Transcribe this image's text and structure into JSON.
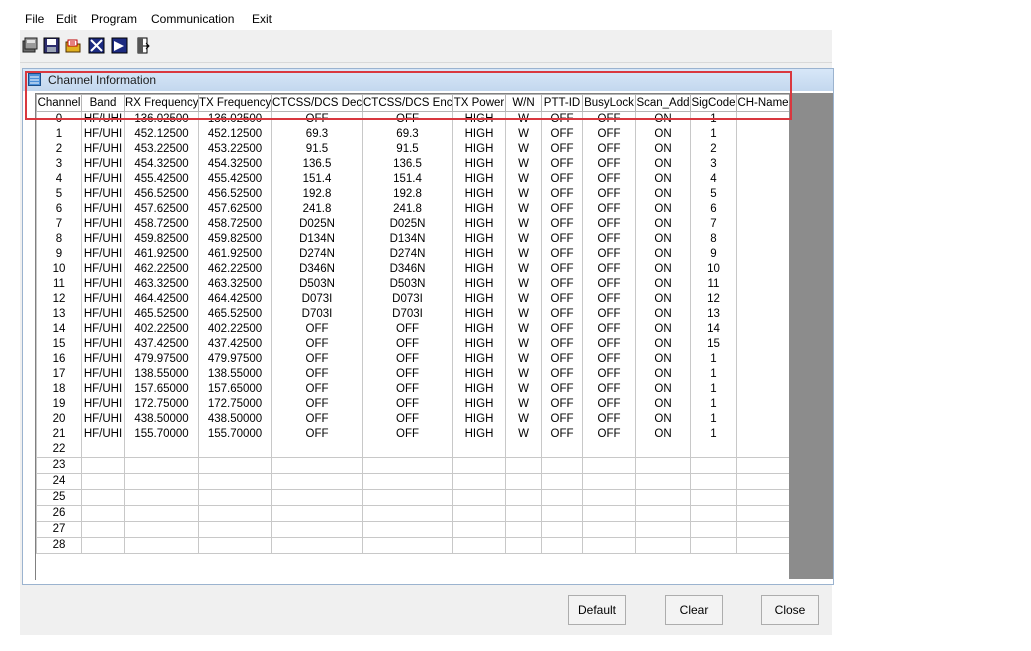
{
  "menu": [
    "File",
    "Edit",
    "Program",
    "Communication",
    "Exit"
  ],
  "toolbar": {
    "buttons": [
      {
        "name": "read-radio-icon"
      },
      {
        "name": "save-icon"
      },
      {
        "name": "open-folder-icon"
      },
      {
        "name": "write-radio-icon"
      },
      {
        "name": "read-from-radio-icon"
      },
      {
        "name": "exit-door-icon"
      }
    ]
  },
  "window": {
    "title": "Channel Information",
    "icon": "grid-window-icon"
  },
  "grid": {
    "columns": [
      "Channel",
      "Band",
      "RX Frequency",
      "TX Frequency",
      "CTCSS/DCS Dec",
      "CTCSS/DCS Enc",
      "TX Power",
      "W/N",
      "PTT-ID",
      "BusyLock",
      "Scan_Add",
      "SigCode",
      "CH-Name"
    ],
    "rows": [
      [
        "0",
        "HF/UHI",
        "136.02500",
        "136.02500",
        "OFF",
        "OFF",
        "HIGH",
        "W",
        "OFF",
        "OFF",
        "ON",
        "1",
        ""
      ],
      [
        "1",
        "HF/UHI",
        "452.12500",
        "452.12500",
        "69.3",
        "69.3",
        "HIGH",
        "W",
        "OFF",
        "OFF",
        "ON",
        "1",
        ""
      ],
      [
        "2",
        "HF/UHI",
        "453.22500",
        "453.22500",
        "91.5",
        "91.5",
        "HIGH",
        "W",
        "OFF",
        "OFF",
        "ON",
        "2",
        ""
      ],
      [
        "3",
        "HF/UHI",
        "454.32500",
        "454.32500",
        "136.5",
        "136.5",
        "HIGH",
        "W",
        "OFF",
        "OFF",
        "ON",
        "3",
        ""
      ],
      [
        "4",
        "HF/UHI",
        "455.42500",
        "455.42500",
        "151.4",
        "151.4",
        "HIGH",
        "W",
        "OFF",
        "OFF",
        "ON",
        "4",
        ""
      ],
      [
        "5",
        "HF/UHI",
        "456.52500",
        "456.52500",
        "192.8",
        "192.8",
        "HIGH",
        "W",
        "OFF",
        "OFF",
        "ON",
        "5",
        ""
      ],
      [
        "6",
        "HF/UHI",
        "457.62500",
        "457.62500",
        "241.8",
        "241.8",
        "HIGH",
        "W",
        "OFF",
        "OFF",
        "ON",
        "6",
        ""
      ],
      [
        "7",
        "HF/UHI",
        "458.72500",
        "458.72500",
        "D025N",
        "D025N",
        "HIGH",
        "W",
        "OFF",
        "OFF",
        "ON",
        "7",
        ""
      ],
      [
        "8",
        "HF/UHI",
        "459.82500",
        "459.82500",
        "D134N",
        "D134N",
        "HIGH",
        "W",
        "OFF",
        "OFF",
        "ON",
        "8",
        ""
      ],
      [
        "9",
        "HF/UHI",
        "461.92500",
        "461.92500",
        "D274N",
        "D274N",
        "HIGH",
        "W",
        "OFF",
        "OFF",
        "ON",
        "9",
        ""
      ],
      [
        "10",
        "HF/UHI",
        "462.22500",
        "462.22500",
        "D346N",
        "D346N",
        "HIGH",
        "W",
        "OFF",
        "OFF",
        "ON",
        "10",
        ""
      ],
      [
        "11",
        "HF/UHI",
        "463.32500",
        "463.32500",
        "D503N",
        "D503N",
        "HIGH",
        "W",
        "OFF",
        "OFF",
        "ON",
        "11",
        ""
      ],
      [
        "12",
        "HF/UHI",
        "464.42500",
        "464.42500",
        "D073I",
        "D073I",
        "HIGH",
        "W",
        "OFF",
        "OFF",
        "ON",
        "12",
        ""
      ],
      [
        "13",
        "HF/UHI",
        "465.52500",
        "465.52500",
        "D703I",
        "D703I",
        "HIGH",
        "W",
        "OFF",
        "OFF",
        "ON",
        "13",
        ""
      ],
      [
        "14",
        "HF/UHI",
        "402.22500",
        "402.22500",
        "OFF",
        "OFF",
        "HIGH",
        "W",
        "OFF",
        "OFF",
        "ON",
        "14",
        ""
      ],
      [
        "15",
        "HF/UHI",
        "437.42500",
        "437.42500",
        "OFF",
        "OFF",
        "HIGH",
        "W",
        "OFF",
        "OFF",
        "ON",
        "15",
        ""
      ],
      [
        "16",
        "HF/UHI",
        "479.97500",
        "479.97500",
        "OFF",
        "OFF",
        "HIGH",
        "W",
        "OFF",
        "OFF",
        "ON",
        "1",
        ""
      ],
      [
        "17",
        "HF/UHI",
        "138.55000",
        "138.55000",
        "OFF",
        "OFF",
        "HIGH",
        "W",
        "OFF",
        "OFF",
        "ON",
        "1",
        ""
      ],
      [
        "18",
        "HF/UHI",
        "157.65000",
        "157.65000",
        "OFF",
        "OFF",
        "HIGH",
        "W",
        "OFF",
        "OFF",
        "ON",
        "1",
        ""
      ],
      [
        "19",
        "HF/UHI",
        "172.75000",
        "172.75000",
        "OFF",
        "OFF",
        "HIGH",
        "W",
        "OFF",
        "OFF",
        "ON",
        "1",
        ""
      ],
      [
        "20",
        "HF/UHI",
        "438.50000",
        "438.50000",
        "OFF",
        "OFF",
        "HIGH",
        "W",
        "OFF",
        "OFF",
        "ON",
        "1",
        ""
      ],
      [
        "21",
        "HF/UHI",
        "155.70000",
        "155.70000",
        "OFF",
        "OFF",
        "HIGH",
        "W",
        "OFF",
        "OFF",
        "ON",
        "1",
        ""
      ],
      [
        "22",
        "",
        "",
        "",
        "",
        "",
        "",
        "",
        "",
        "",
        "",
        "",
        ""
      ],
      [
        "23",
        "",
        "",
        "",
        "",
        "",
        "",
        "",
        "",
        "",
        "",
        "",
        ""
      ],
      [
        "24",
        "",
        "",
        "",
        "",
        "",
        "",
        "",
        "",
        "",
        "",
        "",
        ""
      ],
      [
        "25",
        "",
        "",
        "",
        "",
        "",
        "",
        "",
        "",
        "",
        "",
        "",
        ""
      ],
      [
        "26",
        "",
        "",
        "",
        "",
        "",
        "",
        "",
        "",
        "",
        "",
        "",
        ""
      ],
      [
        "27",
        "",
        "",
        "",
        "",
        "",
        "",
        "",
        "",
        "",
        "",
        "",
        ""
      ],
      [
        "28",
        "",
        "",
        "",
        "",
        "",
        "",
        "",
        "",
        "",
        "",
        "",
        ""
      ]
    ]
  },
  "buttons": {
    "default": "Default",
    "clear": "Clear",
    "close": "Close"
  },
  "highlight_color": "#d9383f"
}
